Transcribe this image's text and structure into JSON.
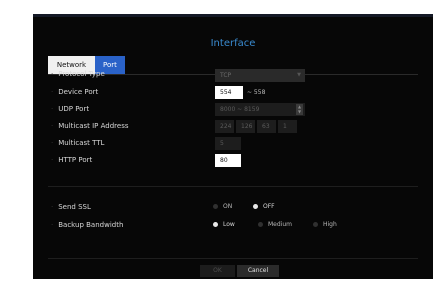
{
  "title": "Interface",
  "tabs": [
    {
      "label": "Network",
      "active": false
    },
    {
      "label": "Port",
      "active": true
    }
  ],
  "rows": {
    "protocol_type": {
      "label": "Protocol Type",
      "value": "TCP"
    },
    "device_port": {
      "label": "Device Port",
      "value": "554",
      "range_end": "~ 558"
    },
    "udp_port": {
      "label": "UDP Port",
      "value": "8000 ~ 8159"
    },
    "multicast_ip": {
      "label": "Multicast IP Address",
      "octets": [
        "224",
        "126",
        "63",
        "1"
      ]
    },
    "multicast_ttl": {
      "label": "Multicast TTL",
      "value": "5"
    },
    "http_port": {
      "label": "HTTP Port",
      "value": "80"
    }
  },
  "send_ssl": {
    "label": "Send SSL",
    "options": [
      "ON",
      "OFF"
    ],
    "selected": "OFF"
  },
  "backup_bandwidth": {
    "label": "Backup Bandwidth",
    "options": [
      "Low",
      "Medium",
      "High"
    ],
    "selected": "Low"
  },
  "buttons": {
    "ok": "OK",
    "cancel": "Cancel"
  },
  "colors": {
    "accent": "#3a8bd0",
    "tab_active": "#2a62c8",
    "background": "#070707"
  }
}
